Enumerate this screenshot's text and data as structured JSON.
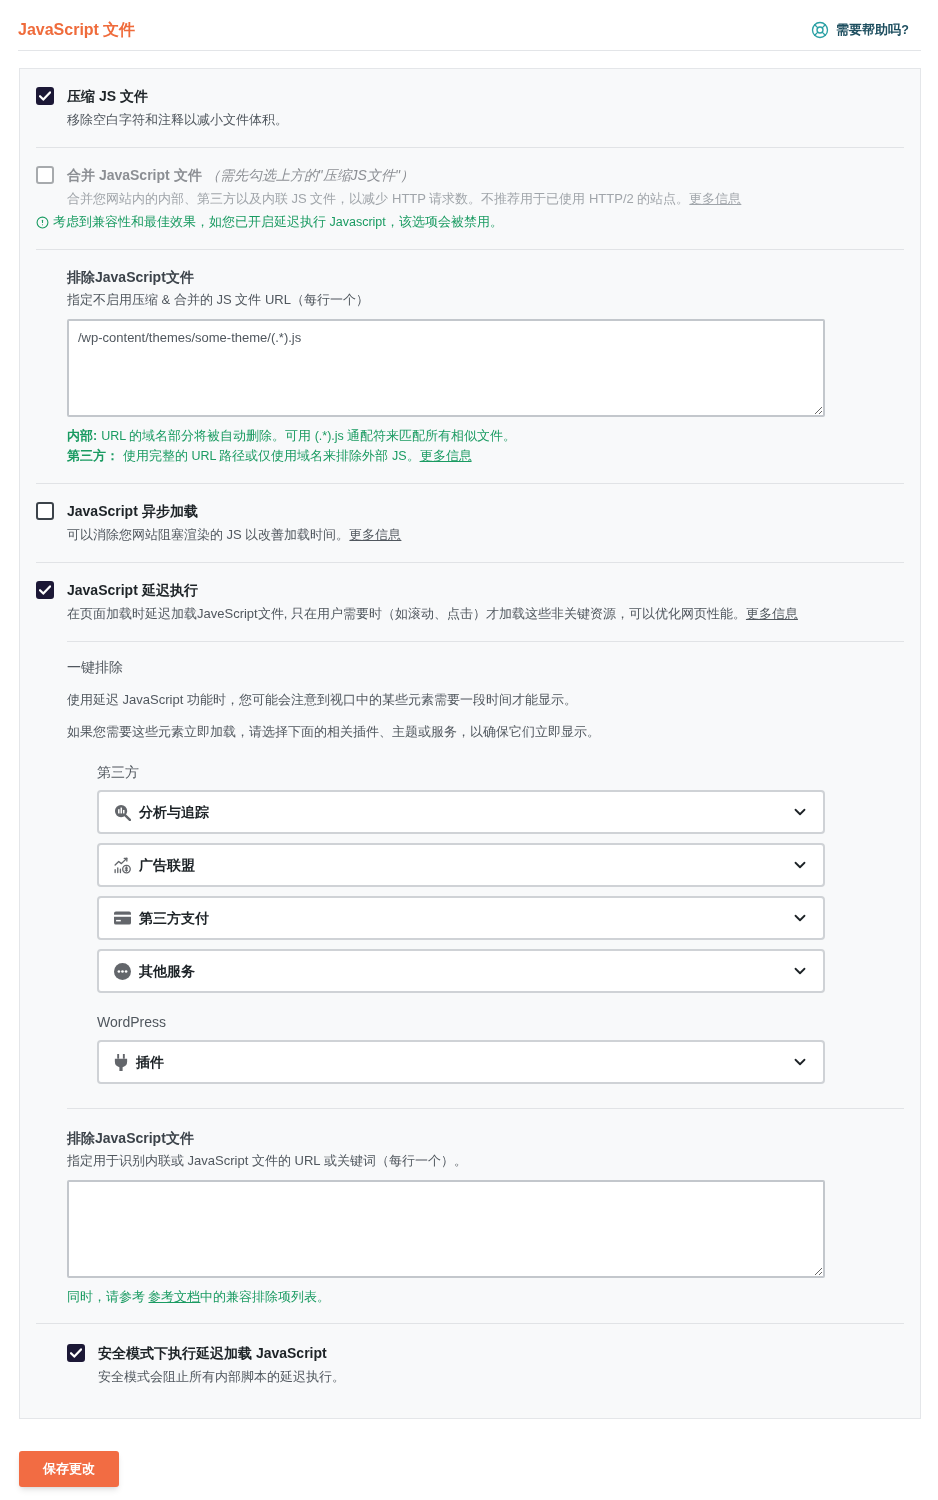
{
  "header": {
    "title": "JavaScript 文件",
    "help_link": "需要帮助吗?"
  },
  "settings": [
    {
      "kind": "checkbox",
      "label": "压缩 JS 文件",
      "checked": true,
      "disabled": false,
      "description": [
        {
          "kind": "text",
          "text": "移除空白字符和注释以减小文件体积。"
        }
      ]
    },
    {
      "kind": "checkbox",
      "label": "合并 JavaScript 文件",
      "note": "（需先勾选上方的\"压缩JS文件\"）",
      "checked": false,
      "disabled": true,
      "description": [
        {
          "kind": "text",
          "text": "合并您网站内的内部、第三方以及内联 JS 文件，以减少 HTTP 请求数。不推荐用于已使用 HTTP/2 的站点。"
        },
        {
          "kind": "link",
          "text": "更多信息"
        }
      ],
      "warning": "考虑到兼容性和最佳效果，如您已开启延迟执行 Javascript，该选项会被禁用。"
    },
    {
      "kind": "textarea",
      "label": "排除JavaScript文件",
      "description": "指定不启用压缩 & 合并的 JS 文件 URL（每行一个）",
      "value": "/wp-content/themes/some-theme/(.*).js",
      "hints": [
        [
          {
            "kind": "bold",
            "text": "内部:"
          },
          {
            "kind": "text",
            "text": "URL 的域名部分将被自动删除。可用 (.*).js 通配符来匹配所有相似文件。"
          }
        ],
        [
          {
            "kind": "bold",
            "text": "第三方："
          },
          {
            "kind": "text",
            "text": "使用完整的 URL 路径或仅使用域名来排除外部 JS。"
          },
          {
            "kind": "link",
            "text": "更多信息"
          }
        ]
      ]
    },
    {
      "kind": "checkbox",
      "label": "JavaScript 异步加载",
      "checked": false,
      "disabled": false,
      "description": [
        {
          "kind": "text",
          "text": "可以消除您网站阻塞渲染的 JS 以改善加载时间。"
        },
        {
          "kind": "link",
          "text": "更多信息"
        }
      ]
    },
    {
      "kind": "checkbox",
      "label": "JavaScript 延迟执行",
      "checked": true,
      "disabled": false,
      "description": [
        {
          "kind": "text",
          "text": "在页面加载时延迟加载JaveScript文件, 只在用户需要时（如滚动、点击）才加载这些非关键资源，可以优化网页性能。"
        },
        {
          "kind": "link",
          "text": "更多信息"
        }
      ],
      "children": [
        {
          "kind": "exclusions",
          "title": "一键排除",
          "paragraphs": [
            "使用延迟 JavaScript 功能时，您可能会注意到视口中的某些元素需要一段时间才能显示。",
            "如果您需要这些元素立即加载，请选择下面的相关插件、主题或服务，以确保它们立即显示。"
          ],
          "groups": [
            {
              "label": "第三方",
              "items": [
                {
                  "kind": "analytics",
                  "label": "分析与追踪",
                  "expanded": false
                },
                {
                  "kind": "ads",
                  "label": "广告联盟",
                  "expanded": false
                },
                {
                  "kind": "payment",
                  "label": "第三方支付",
                  "expanded": false
                },
                {
                  "kind": "services",
                  "label": "其他服务",
                  "expanded": false
                }
              ]
            },
            {
              "label": "WordPress",
              "items": [
                {
                  "kind": "plugin",
                  "label": "插件",
                  "expanded": false
                }
              ]
            }
          ]
        },
        {
          "kind": "textarea",
          "label": "排除JavaScript文件",
          "description": "指定用于识别内联或 JavaScript 文件的 URL 或关键词（每行一个）。",
          "hints": [
            [
              {
                "kind": "text",
                "text": "同时，请参考 "
              },
              {
                "kind": "link",
                "text": "参考文档"
              },
              {
                "kind": "text",
                "text": "中的兼容排除项列表。"
              }
            ]
          ]
        },
        {
          "kind": "checkbox",
          "label": "安全模式下执行延迟加载 JavaScript",
          "checked": true,
          "disabled": false,
          "description": [
            {
              "kind": "text",
              "text": "安全模式会阻止所有内部脚本的延迟执行。"
            }
          ]
        }
      ]
    }
  ],
  "save_button": "保存更改"
}
